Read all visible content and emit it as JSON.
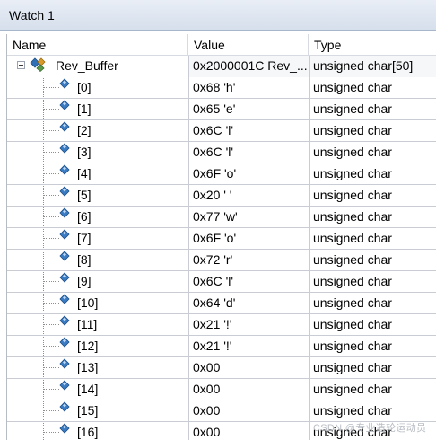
{
  "window": {
    "title": "Watch 1"
  },
  "columns": {
    "name": "Name",
    "value": "Value",
    "type": "Type"
  },
  "parent": {
    "name": "Rev_Buffer",
    "value": "0x2000001C Rev_...",
    "type": "unsigned char[50]"
  },
  "children": [
    {
      "name": "[0]",
      "value": "0x68 'h'",
      "type": "unsigned char"
    },
    {
      "name": "[1]",
      "value": "0x65 'e'",
      "type": "unsigned char"
    },
    {
      "name": "[2]",
      "value": "0x6C 'l'",
      "type": "unsigned char"
    },
    {
      "name": "[3]",
      "value": "0x6C 'l'",
      "type": "unsigned char"
    },
    {
      "name": "[4]",
      "value": "0x6F 'o'",
      "type": "unsigned char"
    },
    {
      "name": "[5]",
      "value": "0x20 ' '",
      "type": "unsigned char"
    },
    {
      "name": "[6]",
      "value": "0x77 'w'",
      "type": "unsigned char"
    },
    {
      "name": "[7]",
      "value": "0x6F 'o'",
      "type": "unsigned char"
    },
    {
      "name": "[8]",
      "value": "0x72 'r'",
      "type": "unsigned char"
    },
    {
      "name": "[9]",
      "value": "0x6C 'l'",
      "type": "unsigned char"
    },
    {
      "name": "[10]",
      "value": "0x64 'd'",
      "type": "unsigned char"
    },
    {
      "name": "[11]",
      "value": "0x21 '!'",
      "type": "unsigned char"
    },
    {
      "name": "[12]",
      "value": "0x21 '!'",
      "type": "unsigned char"
    },
    {
      "name": "[13]",
      "value": "0x00",
      "type": "unsigned char"
    },
    {
      "name": "[14]",
      "value": "0x00",
      "type": "unsigned char"
    },
    {
      "name": "[15]",
      "value": "0x00",
      "type": "unsigned char"
    },
    {
      "name": "[16]",
      "value": "0x00",
      "type": "unsigned char"
    }
  ],
  "icons": {
    "expander": "collapse-minus-icon",
    "parent": "struct-variable-icon",
    "child": "variable-diamond-icon"
  },
  "watermark": "CSDN @专业造轮运动员"
}
